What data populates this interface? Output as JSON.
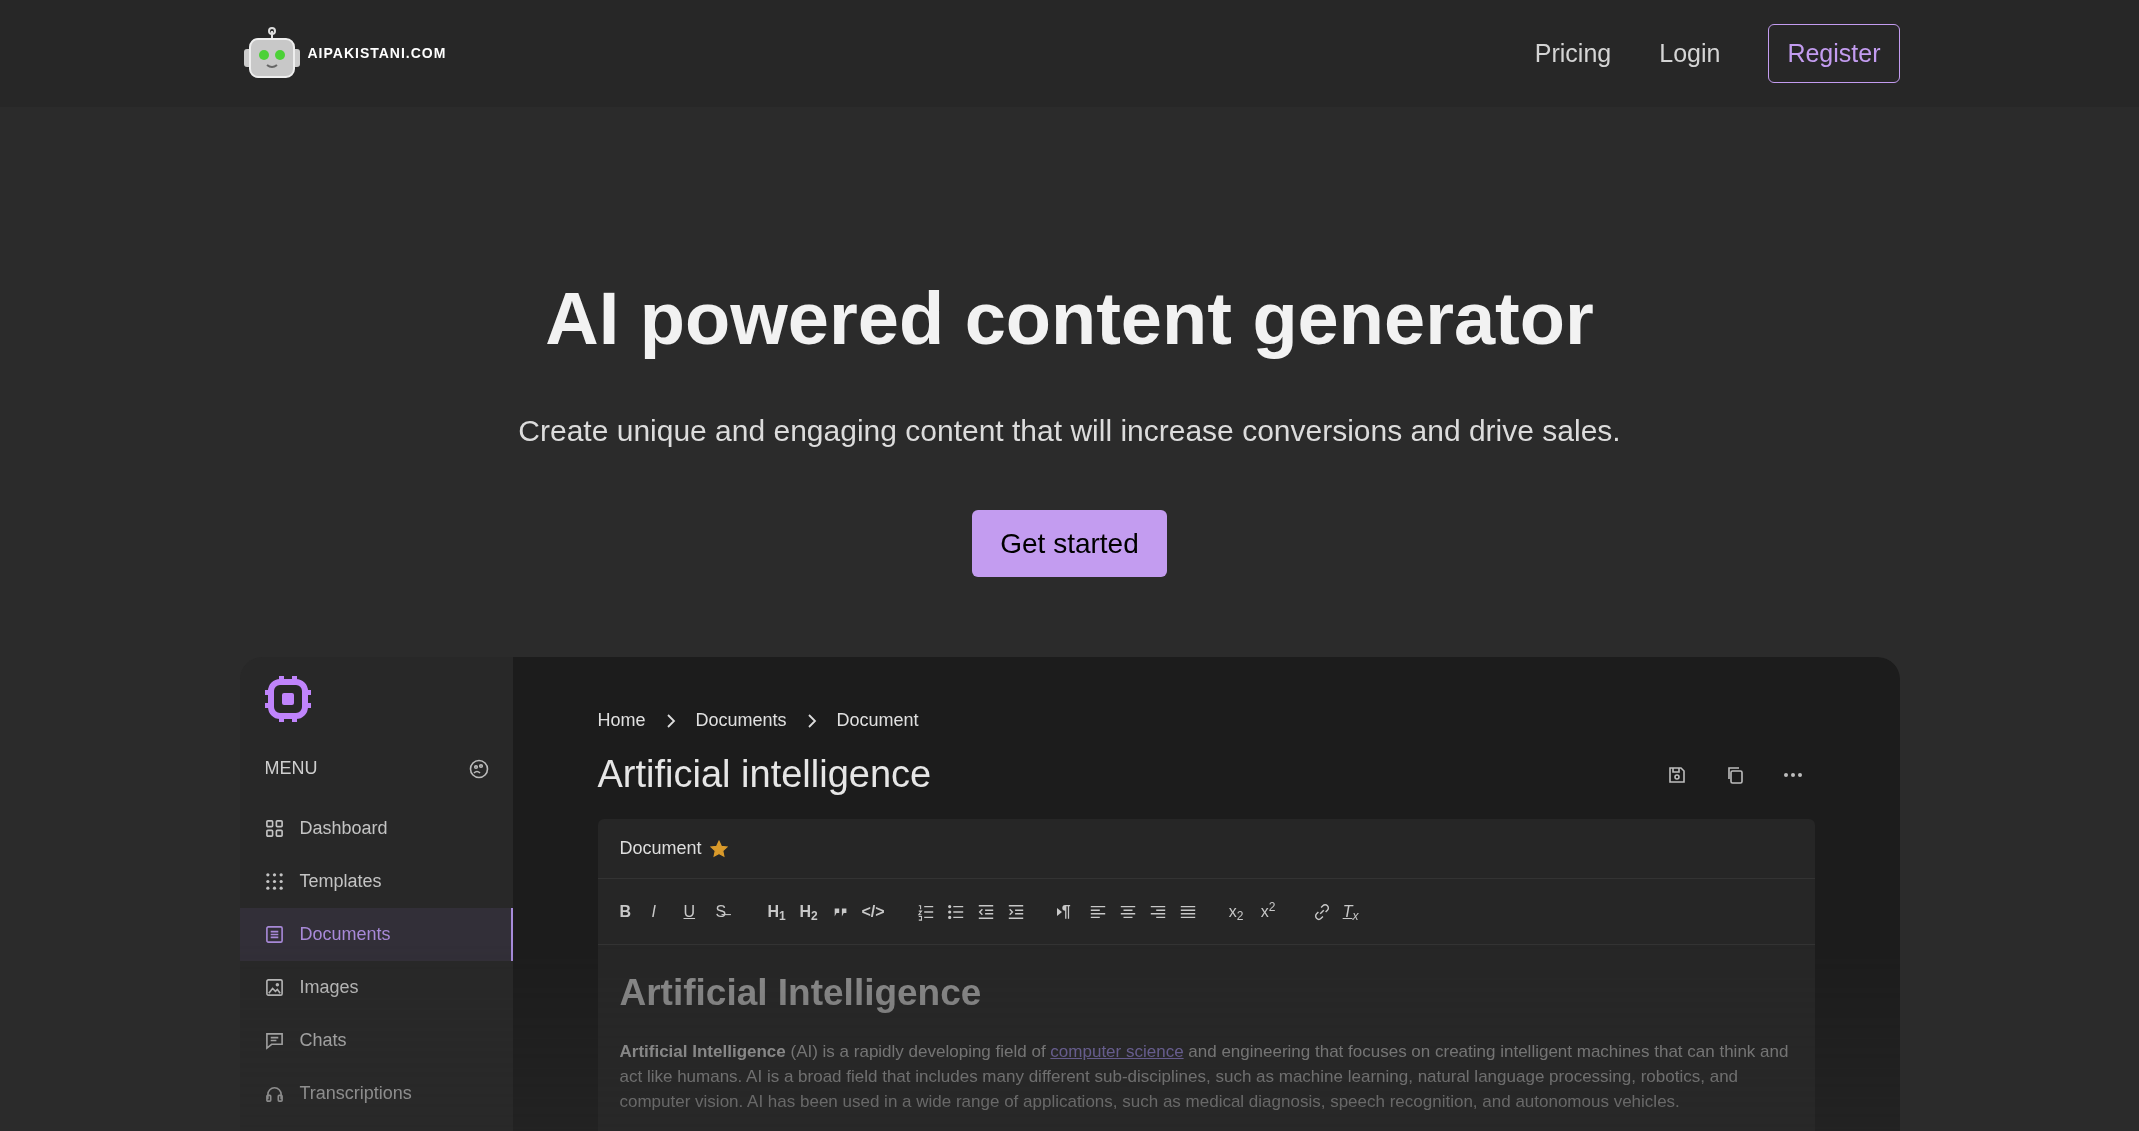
{
  "header": {
    "logo_text": "AIPAKISTANI.COM",
    "nav": [
      {
        "label": "Pricing",
        "kind": "link"
      },
      {
        "label": "Login",
        "kind": "link"
      },
      {
        "label": "Register",
        "kind": "outline"
      }
    ]
  },
  "hero": {
    "title": "AI powered content generator",
    "subtitle": "Create unique and engaging content that will increase conversions and drive sales.",
    "cta": "Get started"
  },
  "app": {
    "sidebar": {
      "menu_label": "MENU",
      "items": [
        {
          "label": "Dashboard",
          "kind": "dashboard",
          "selected": false
        },
        {
          "label": "Templates",
          "kind": "templates",
          "selected": false
        },
        {
          "label": "Documents",
          "kind": "documents",
          "selected": true
        },
        {
          "label": "Images",
          "kind": "images",
          "selected": false
        },
        {
          "label": "Chats",
          "kind": "chats",
          "selected": false
        },
        {
          "label": "Transcriptions",
          "kind": "transcriptions",
          "selected": false
        }
      ]
    },
    "breadcrumb": [
      "Home",
      "Documents",
      "Document"
    ],
    "title": "Artificial intelligence",
    "document": {
      "label": "Document",
      "starred": true,
      "toolbar": [
        [
          {
            "kind": "bold",
            "label": "B"
          },
          {
            "kind": "italic",
            "label": "I"
          },
          {
            "kind": "underline",
            "label": "U"
          },
          {
            "kind": "strike",
            "label": "S̶"
          }
        ],
        [
          {
            "kind": "heading",
            "label": "H$_{1}$"
          },
          {
            "kind": "heading",
            "label": "H$_{2}$"
          },
          {
            "kind": "quote"
          },
          {
            "kind": "code",
            "label": "</>"
          }
        ],
        [
          {
            "kind": "ol"
          },
          {
            "kind": "ul"
          },
          {
            "kind": "outdent"
          },
          {
            "kind": "indent"
          }
        ],
        [
          {
            "kind": "rtl",
            "label": "¶"
          },
          {
            "kind": "left"
          },
          {
            "kind": "center"
          },
          {
            "kind": "right"
          },
          {
            "kind": "justify"
          }
        ],
        [
          {
            "kind": "script",
            "label": "x$_{2}$"
          },
          {
            "kind": "script",
            "label": "x$^{2}$"
          }
        ],
        [
          {
            "kind": "link"
          },
          {
            "kind": "clear",
            "label": "T$_{x}$"
          }
        ]
      ],
      "heading": "Artificial Intelligence",
      "paragraph": {
        "before": "**Artificial Intelligence** (AI) is a rapidly developing field of",
        "link": "computer science",
        "after": "and engineering that focuses on creating intelligent machines that can think and act like humans. AI is a broad field that includes many different sub-disciplines, such as machine learning, natural language processing, robotics, and computer vision. AI has been used in a wide range of applications, such as medical diagnosis, speech recognition, and autonomous vehicles."
      }
    }
  }
}
